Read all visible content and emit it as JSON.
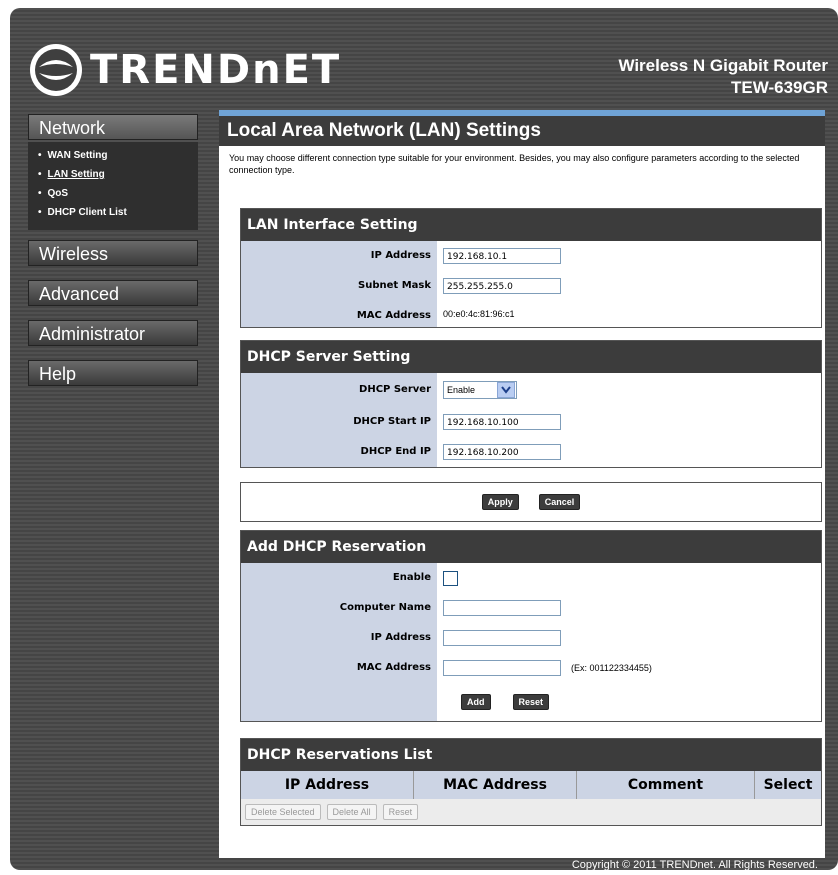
{
  "brand": {
    "name": "TRENDnET",
    "logo_icon": "trendnet-logo-icon"
  },
  "product": {
    "line1": "Wireless N Gigabit Router",
    "line2": "TEW-639GR"
  },
  "sidebar": {
    "network": "Network",
    "network_items": [
      "WAN Setting",
      "LAN Setting",
      "QoS",
      "DHCP Client List"
    ],
    "wireless": "Wireless",
    "advanced": "Advanced",
    "administrator": "Administrator",
    "help": "Help"
  },
  "main": {
    "title": "Local Area Network (LAN) Settings",
    "intro": "You may choose different connection type suitable for your environment. Besides, you may also configure parameters according to the selected connection type."
  },
  "lan": {
    "heading": "LAN Interface Setting",
    "ip_label": "IP Address",
    "ip_value": "192.168.10.1",
    "mask_label": "Subnet Mask",
    "mask_value": "255.255.255.0",
    "mac_label": "MAC Address",
    "mac_value": "00:e0:4c:81:96:c1"
  },
  "dhcp": {
    "heading": "DHCP Server Setting",
    "server_label": "DHCP Server",
    "server_value": "Enable",
    "start_label": "DHCP Start IP",
    "start_value": "192.168.10.100",
    "end_label": "DHCP End IP",
    "end_value": "192.168.10.200"
  },
  "actions": {
    "apply": "Apply",
    "cancel": "Cancel"
  },
  "reservation": {
    "heading": "Add DHCP Reservation",
    "enable_label": "Enable",
    "name_label": "Computer Name",
    "ip_label": "IP Address",
    "mac_label": "MAC Address",
    "mac_example": "(Ex: 001122334455)",
    "add": "Add",
    "reset": "Reset"
  },
  "list": {
    "heading": "DHCP Reservations List",
    "columns": [
      "IP Address",
      "MAC Address",
      "Comment",
      "Select"
    ],
    "delete_selected": "Delete Selected",
    "delete_all": "Delete All",
    "reset": "Reset"
  },
  "footer": {
    "copyright": "Copyright © 2011 TRENDnet. All Rights Reserved."
  },
  "colors": {
    "frame": "#4a4a4a",
    "header_bar": "#3c3c3c",
    "label_bg": "#ccd4e4",
    "accent_line": "#6fa3d6"
  }
}
